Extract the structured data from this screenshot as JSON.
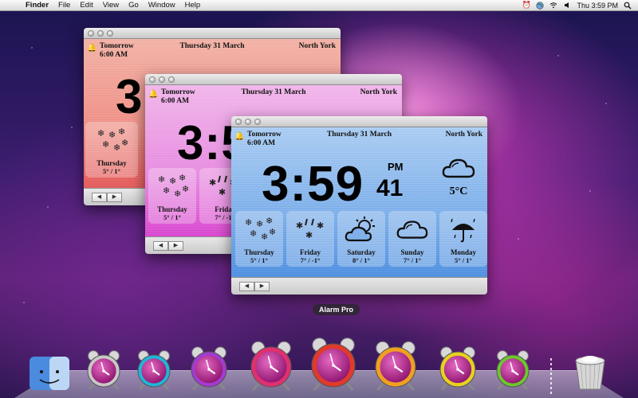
{
  "menubar": {
    "app_name": "Finder",
    "menus": [
      "File",
      "Edit",
      "View",
      "Go",
      "Window",
      "Help"
    ],
    "clock": "Thu 3:59 PM",
    "status_icons": [
      "alarm-clock-icon",
      "globe-icon",
      "wifi-icon",
      "volume-icon",
      "spotlight-icon"
    ]
  },
  "windows": [
    {
      "alarm_label": "Tomorrow",
      "alarm_time": "6:00 AM",
      "date": "Thursday 31 March",
      "city": "North York",
      "clock_visible": "3",
      "days": [
        {
          "name": "Thursday",
          "temp": "5° / 1°",
          "icon": "snow-icon"
        }
      ]
    },
    {
      "alarm_label": "Tomorrow",
      "alarm_time": "6:00 AM",
      "date": "Thursday 31 March",
      "city": "North York",
      "clock_visible": "3:5",
      "days": [
        {
          "name": "Thursday",
          "temp": "5° / 1°",
          "icon": "snow-icon"
        },
        {
          "name": "Frida",
          "temp": "7° / -1",
          "icon": "sleet-icon"
        }
      ]
    },
    {
      "alarm_label": "Tomorrow",
      "alarm_time": "6:00 AM",
      "date": "Thursday 31 March",
      "city": "North York",
      "clock": "3:59",
      "ampm": "PM",
      "seconds": "41",
      "current_temp": "5°C",
      "current_icon": "cloudy-icon",
      "days": [
        {
          "name": "Thursday",
          "temp": "5° / 1°",
          "icon": "snow-icon"
        },
        {
          "name": "Friday",
          "temp": "7° / -1°",
          "icon": "sleet-icon"
        },
        {
          "name": "Saturday",
          "temp": "8° / 1°",
          "icon": "partly-sunny-icon"
        },
        {
          "name": "Sunday",
          "temp": "7° / 1°",
          "icon": "cloudy-icon"
        },
        {
          "name": "Monday",
          "temp": "5° / 1°",
          "icon": "rain-umbrella-icon"
        }
      ]
    }
  ],
  "nav": {
    "prev": "◀",
    "next": "▶"
  },
  "dock": {
    "tooltip": "Alarm Pro",
    "items": [
      {
        "name": "finder",
        "ring": "#4a8be0"
      },
      {
        "name": "alarm-silver",
        "ring": "#c8c8c8"
      },
      {
        "name": "alarm-cyan",
        "ring": "#1fb6d9"
      },
      {
        "name": "alarm-purple",
        "ring": "#a23bd0"
      },
      {
        "name": "alarm-pink",
        "ring": "#e0306e"
      },
      {
        "name": "alarm-red",
        "ring": "#e03a2a"
      },
      {
        "name": "alarm-orange",
        "ring": "#f0a020"
      },
      {
        "name": "alarm-yellow",
        "ring": "#e6d21f"
      },
      {
        "name": "alarm-green",
        "ring": "#6cc82c"
      },
      {
        "name": "trash",
        "ring": "#aaaaaa"
      }
    ]
  }
}
